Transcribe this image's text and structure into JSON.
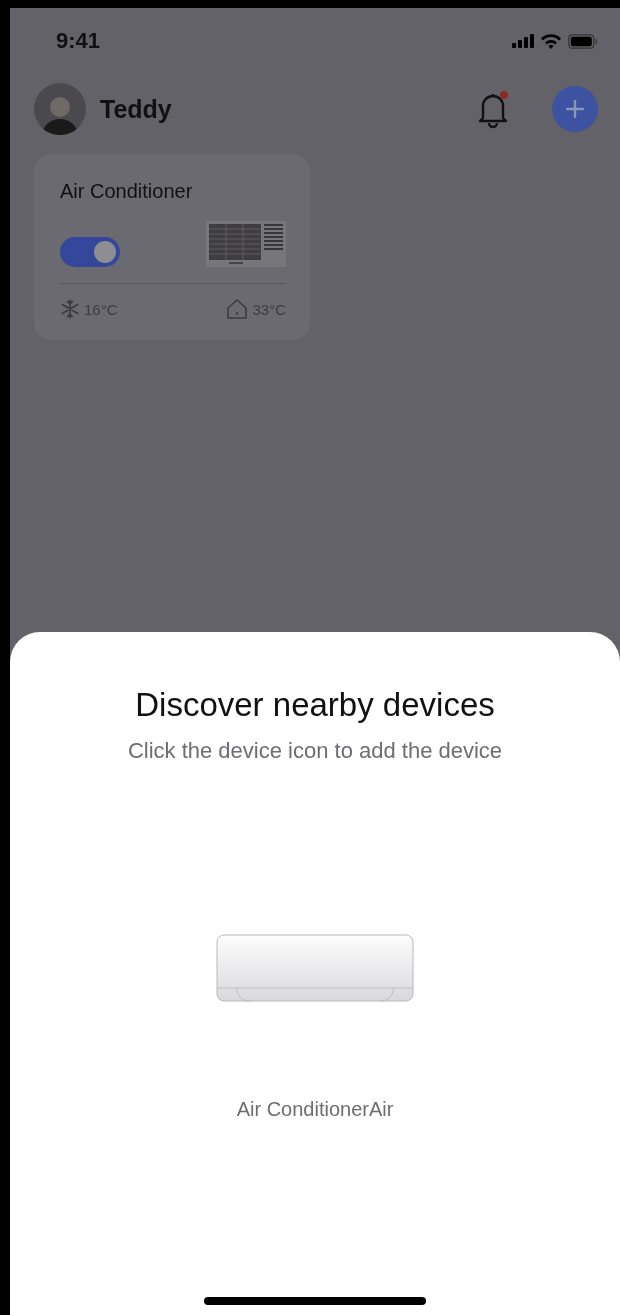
{
  "status_bar": {
    "time": "9:41"
  },
  "header": {
    "user_name": "Teddy",
    "notification_badge": true
  },
  "devices": [
    {
      "name": "Air Conditioner",
      "on": true,
      "set_temperature": "16°C",
      "room_temperature": "33°C"
    }
  ],
  "sheet": {
    "title": "Discover nearby devices",
    "subtitle": "Click the device icon to add the device",
    "discovered": [
      {
        "name": "Air ConditionerAir"
      }
    ]
  }
}
